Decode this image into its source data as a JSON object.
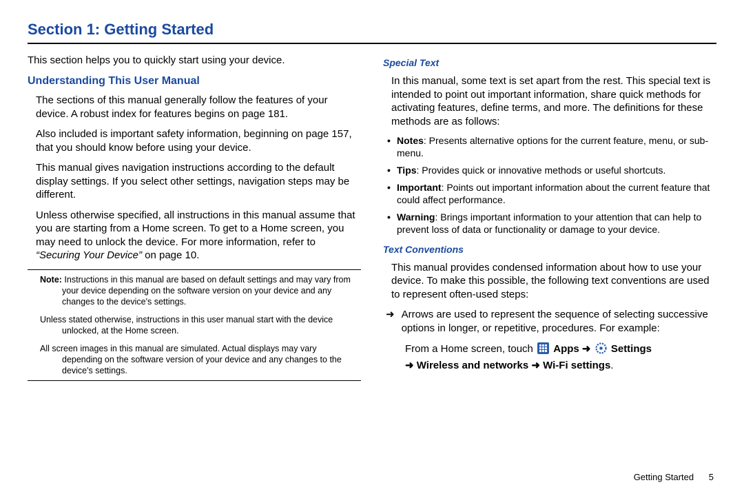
{
  "title": "Section 1: Getting Started",
  "intro": "This section helps you to quickly start using your device.",
  "subheading": "Understanding This User Manual",
  "left": {
    "p1": "The sections of this manual generally follow the features of your device. A robust index for features begins on page 181.",
    "p2": "Also included is important safety information, beginning on page 157, that you should know before using your device.",
    "p3": "This manual gives navigation instructions according to the default display settings. If you select other settings, navigation steps may be different.",
    "p4a": "Unless otherwise specified, all instructions in this manual assume that you are starting from a Home screen. To get to a Home screen, you may need to unlock the device. For more information, refer to ",
    "p4quote": "“Securing Your Device”",
    "p4b": "  on page 10.",
    "note_label": "Note:",
    "note1_body": " Instructions in this manual are based on default settings and may vary from your device depending on the software version on your device and any changes to the device's settings.",
    "note2": "Unless stated otherwise, instructions in this user manual start with the device unlocked, at the Home screen.",
    "note3": "All screen images in this manual are simulated. Actual displays may vary depending on the software version of your device and any changes to the device's settings."
  },
  "right": {
    "topic1": "Special Text",
    "p1": "In this manual, some text is set apart from the rest. This special text is intended to point out important information, share quick methods for activating features, define terms, and more. The definitions for these methods are as follows:",
    "bullets": {
      "notes_label": "Notes",
      "notes_body": ": Presents alternative options for the current feature, menu, or sub-menu.",
      "tips_label": "Tips",
      "tips_body": ": Provides quick or innovative methods or useful shortcuts.",
      "important_label": "Important",
      "important_body": ": Points out important information about the current feature that could affect performance.",
      "warning_label": "Warning",
      "warning_body": ": Brings important information to your attention that can help to prevent loss of data or functionality or damage to your device."
    },
    "topic2": "Text Conventions",
    "p2": "This manual provides condensed information about how to use your device. To make this possible, the following text conventions are used to represent often-used steps:",
    "arrow_sym": "➜",
    "arrow_text": "Arrows are used to represent the sequence of selecting successive options in longer, or repetitive, procedures. For example:",
    "example": {
      "lead": "From a Home screen, touch ",
      "apps": " Apps ",
      "arrow1": "➜ ",
      "settings": " Settings ",
      "arrow2": "➜",
      "wireless": " Wireless and networks ",
      "arrow3": "➜",
      "wifi": " Wi-Fi settings",
      "period": "."
    }
  },
  "footer": {
    "name": "Getting Started",
    "page": "5"
  }
}
